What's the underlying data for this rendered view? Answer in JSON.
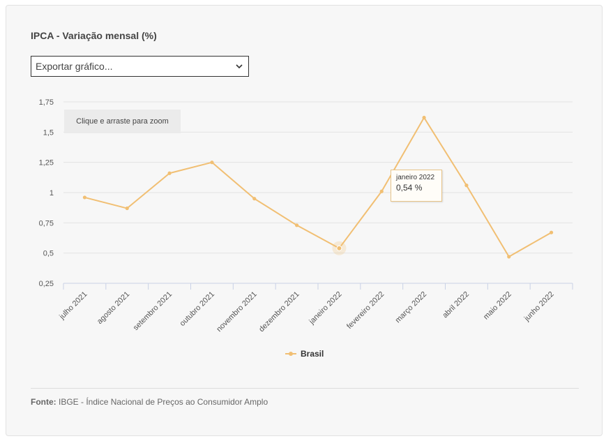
{
  "title": "IPCA - Variação mensal (%)",
  "export": {
    "selected": "Exportar gráfico..."
  },
  "zoom_hint": "Clique e arraste para zoom",
  "tooltip": {
    "category": "janeiro 2022",
    "value": "0,54 %"
  },
  "legend": {
    "label": "Brasil"
  },
  "source": {
    "label": "Fonte:",
    "text": "IBGE - Índice Nacional de Preços ao Consumidor Amplo"
  },
  "colors": {
    "series": "#f1bf73",
    "background": "#f7f7f7",
    "grid": "#e3e3e3",
    "axis": "#c9d2e6"
  },
  "chart_data": {
    "type": "line",
    "title": "IPCA - Variação mensal (%)",
    "xlabel": "",
    "ylabel": "",
    "categories": [
      "julho 2021",
      "agosto 2021",
      "setembro 2021",
      "outubro 2021",
      "novembro 2021",
      "dezembro 2021",
      "janeiro 2022",
      "fevereiro 2022",
      "março 2022",
      "abril 2022",
      "maio 2022",
      "junho 2022"
    ],
    "series": [
      {
        "name": "Brasil",
        "values": [
          0.96,
          0.87,
          1.16,
          1.25,
          0.95,
          0.73,
          0.54,
          1.01,
          1.62,
          1.06,
          0.47,
          0.67
        ]
      }
    ],
    "ylim": [
      0.25,
      1.75
    ],
    "yticks": [
      0.25,
      0.5,
      0.75,
      1,
      1.25,
      1.5,
      1.75
    ],
    "ytick_labels": [
      "0,25",
      "0,5",
      "0,75",
      "1",
      "1,25",
      "1,5",
      "1,75"
    ],
    "grid": true,
    "legend_position": "bottom-center",
    "highlighted_category": "janeiro 2022"
  }
}
